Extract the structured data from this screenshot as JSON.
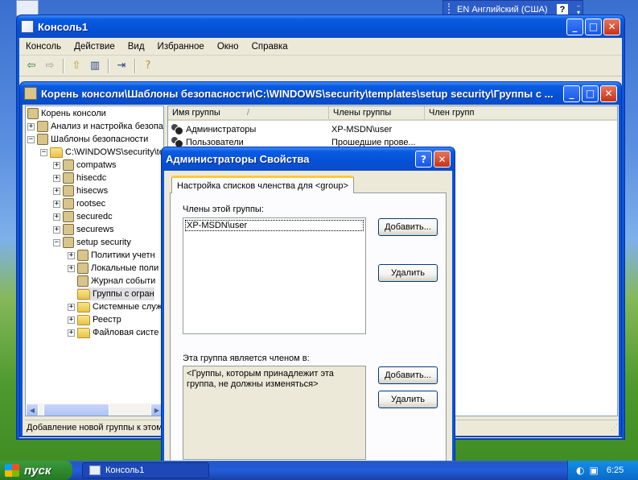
{
  "language_bar": {
    "label": "EN Английский (США)",
    "help": "?"
  },
  "console_window": {
    "title": "Консоль1",
    "menu": [
      "Консоль",
      "Действие",
      "Вид",
      "Избранное",
      "Окно",
      "Справка"
    ]
  },
  "inner_window": {
    "title": "Корень консоли\\Шаблоны безопасности\\C:\\WINDOWS\\security\\templates\\setup security\\Группы с ..."
  },
  "tree": {
    "root": "Корень консоли",
    "items": [
      "Анализ и настройка безопа",
      "Шаблоны безопасности",
      "C:\\WINDOWS\\security\\te",
      "compatws",
      "hisecdc",
      "hisecws",
      "rootsec",
      "securedc",
      "securews",
      "setup security",
      "Политики учетн",
      "Локальные поли",
      "Журнал событи",
      "Группы с огран",
      "Системные служ",
      "Реестр",
      "Файловая систе"
    ]
  },
  "list": {
    "columns": [
      "Имя группы",
      "Члены группы",
      "Член групп"
    ],
    "rows": [
      {
        "name": "Администраторы",
        "members": "XP-MSDN\\user"
      },
      {
        "name": "Пользователи",
        "members": "Прошедшие прове..."
      }
    ]
  },
  "status_text": "Добавление новой группы к этом",
  "dialog": {
    "title": "Администраторы Свойства",
    "help": "?",
    "tab": "Настройка списков членства для <group>",
    "members_label": "Члены этой группы:",
    "members": [
      "XP-MSDN\\user"
    ],
    "add_label": "Добавить...",
    "remove_label": "Удалить",
    "memberof_label": "Эта группа является членом в:",
    "memberof_text": "<Группы, которым принадлежит эта группа, не должны изменяться>"
  },
  "taskbar": {
    "start": "пуск",
    "task": "Консоль1",
    "clock": "6:25"
  }
}
